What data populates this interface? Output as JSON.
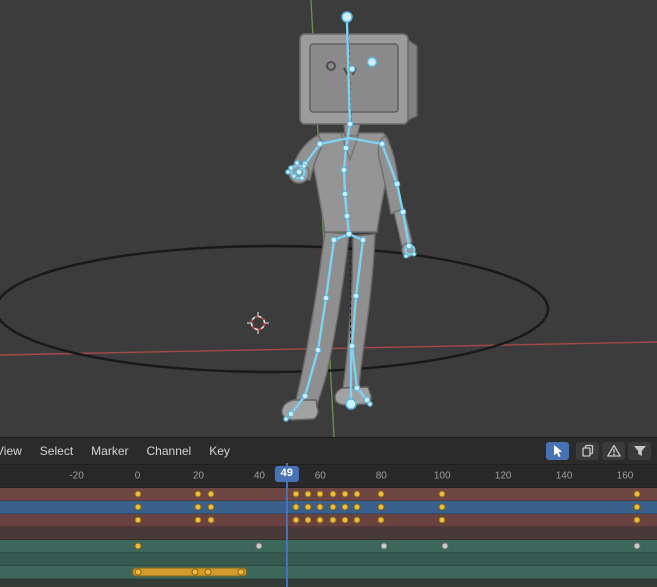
{
  "colors": {
    "accent_blue": "#4772b3",
    "bone_cyan": "#7ed2f2",
    "bone_joint_fill": "#cfeffc",
    "bone_joint_stroke": "#57b7e0",
    "axis_green": "#6a9b4d",
    "axis_red": "#b24b4e",
    "key_selected": "#eebd3c",
    "key_unselected": "#cdcdcd",
    "bar_orange": "#d29b2e"
  },
  "menu": {
    "items": [
      "View",
      "Select",
      "Marker",
      "Channel",
      "Key"
    ]
  },
  "header_icons": [
    {
      "name": "cursor-tool-button",
      "active": true
    },
    {
      "name": "copy-button",
      "active": false
    },
    {
      "name": "warning-button",
      "active": false
    },
    {
      "name": "filter-button",
      "active": false
    }
  ],
  "timeline": {
    "current_frame": 49,
    "ticks": [
      -20,
      0,
      20,
      40,
      60,
      80,
      100,
      120,
      140,
      160
    ]
  },
  "channels": [
    {
      "color": "#6d4543",
      "keys_selected": [
        0,
        20,
        24,
        52,
        56,
        60,
        64,
        68,
        72,
        80,
        100,
        164
      ],
      "keys_unselected": []
    },
    {
      "color": "#38608a",
      "keys_selected": [
        0,
        20,
        24,
        52,
        56,
        60,
        64,
        68,
        72,
        80,
        100,
        164
      ],
      "keys_unselected": []
    },
    {
      "color": "#684241",
      "keys_selected": [
        0,
        20,
        24,
        52,
        56,
        60,
        64,
        68,
        72,
        80,
        100,
        164
      ],
      "keys_unselected": []
    },
    {
      "color": "#473a39",
      "keys_selected": [],
      "keys_unselected": []
    },
    {
      "color": "#3e675b",
      "keys_selected": [
        0
      ],
      "keys_unselected": [
        40,
        81,
        101,
        164
      ]
    },
    {
      "color": "#365a50",
      "keys_selected": [],
      "keys_unselected": []
    },
    {
      "color": "#3e675b",
      "keys_selected": [
        0,
        19,
        23,
        34
      ],
      "keys_unselected": [],
      "bar": [
        0,
        34
      ]
    },
    {
      "color": "#333b37",
      "keys_selected": [],
      "keys_unselected": []
    }
  ]
}
